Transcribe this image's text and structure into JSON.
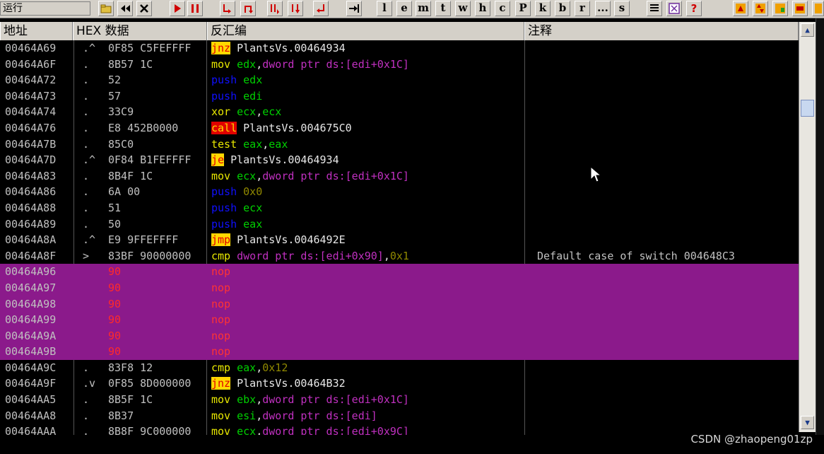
{
  "toolbar": {
    "status_text": "运行",
    "letter_buttons": [
      "l",
      "e",
      "m",
      "t",
      "w",
      "h",
      "c",
      "P",
      "k",
      "b",
      "r",
      "...",
      "s"
    ],
    "help_label": "?"
  },
  "headers": {
    "address": "地址",
    "hex": "HEX 数据",
    "disasm": "反汇编",
    "comment": "注释"
  },
  "rows": [
    {
      "addr": "00464A69",
      "mark": ".^",
      "hex": "0F85 C5FEFFFF",
      "op": "jnz",
      "op_style": "j-yel",
      "args": [
        {
          "t": " PlantsVs.00464934",
          "c": "k-white"
        }
      ],
      "comment": "",
      "sel": false
    },
    {
      "addr": "00464A6F",
      "mark": ".",
      "hex": "8B57 1C",
      "op": "mov",
      "op_style": "k-yel",
      "args": [
        {
          "t": " edx",
          "c": "k-green"
        },
        {
          "t": ",",
          "c": "k-white"
        },
        {
          "t": "dword ptr ds:[edi+0x1C]",
          "c": "k-mag"
        }
      ],
      "comment": "",
      "sel": false
    },
    {
      "addr": "00464A72",
      "mark": ".",
      "hex": "52",
      "op": "push",
      "op_style": "k-blue",
      "args": [
        {
          "t": " edx",
          "c": "k-green"
        }
      ],
      "comment": "",
      "sel": false
    },
    {
      "addr": "00464A73",
      "mark": ".",
      "hex": "57",
      "op": "push",
      "op_style": "k-blue",
      "args": [
        {
          "t": " edi",
          "c": "k-green"
        }
      ],
      "comment": "",
      "sel": false
    },
    {
      "addr": "00464A74",
      "mark": ".",
      "hex": "33C9",
      "op": "xor",
      "op_style": "k-yel",
      "args": [
        {
          "t": " ecx",
          "c": "k-green"
        },
        {
          "t": ",",
          "c": "k-white"
        },
        {
          "t": "ecx",
          "c": "k-green"
        }
      ],
      "comment": "",
      "sel": false
    },
    {
      "addr": "00464A76",
      "mark": ".",
      "hex": "E8 452B0000",
      "op": "call",
      "op_style": "j-red",
      "args": [
        {
          "t": " PlantsVs.004675C0",
          "c": "k-white"
        }
      ],
      "comment": "",
      "sel": false
    },
    {
      "addr": "00464A7B",
      "mark": ".",
      "hex": "85C0",
      "op": "test",
      "op_style": "k-yel",
      "args": [
        {
          "t": " eax",
          "c": "k-green"
        },
        {
          "t": ",",
          "c": "k-white"
        },
        {
          "t": "eax",
          "c": "k-green"
        }
      ],
      "comment": "",
      "sel": false
    },
    {
      "addr": "00464A7D",
      "mark": ".^",
      "hex": "0F84 B1FEFFFF",
      "op": "je",
      "op_style": "j-yel",
      "args": [
        {
          "t": " PlantsVs.00464934",
          "c": "k-white"
        }
      ],
      "comment": "",
      "sel": false
    },
    {
      "addr": "00464A83",
      "mark": ".",
      "hex": "8B4F 1C",
      "op": "mov",
      "op_style": "k-yel",
      "args": [
        {
          "t": " ecx",
          "c": "k-green"
        },
        {
          "t": ",",
          "c": "k-white"
        },
        {
          "t": "dword ptr ds:[edi+0x1C]",
          "c": "k-mag"
        }
      ],
      "comment": "",
      "sel": false
    },
    {
      "addr": "00464A86",
      "mark": ".",
      "hex": "6A 00",
      "op": "push",
      "op_style": "k-blue",
      "args": [
        {
          "t": " 0x0",
          "c": "k-olive"
        }
      ],
      "comment": "",
      "sel": false
    },
    {
      "addr": "00464A88",
      "mark": ".",
      "hex": "51",
      "op": "push",
      "op_style": "k-blue",
      "args": [
        {
          "t": " ecx",
          "c": "k-green"
        }
      ],
      "comment": "",
      "sel": false
    },
    {
      "addr": "00464A89",
      "mark": ".",
      "hex": "50",
      "op": "push",
      "op_style": "k-blue",
      "args": [
        {
          "t": " eax",
          "c": "k-green"
        }
      ],
      "comment": "",
      "sel": false
    },
    {
      "addr": "00464A8A",
      "mark": ".^",
      "hex": "E9 9FFEFFFF",
      "op": "jmp",
      "op_style": "j-yel",
      "args": [
        {
          "t": " PlantsVs.0046492E",
          "c": "k-white"
        }
      ],
      "comment": "",
      "sel": false
    },
    {
      "addr": "00464A8F",
      "mark": ">",
      "hex": "83BF 90000000",
      "op": "cmp",
      "op_style": "k-yel",
      "args": [
        {
          "t": " dword ptr ds:[edi+0x90]",
          "c": "k-mag"
        },
        {
          "t": ",",
          "c": "k-white"
        },
        {
          "t": "0x1",
          "c": "k-olive"
        }
      ],
      "comment": "Default case of switch 004648C3",
      "sel": false
    },
    {
      "addr": "00464A96",
      "mark": "",
      "hex": "90",
      "op": "nop",
      "op_style": "",
      "args": [],
      "comment": "",
      "sel": true
    },
    {
      "addr": "00464A97",
      "mark": "",
      "hex": "90",
      "op": "nop",
      "op_style": "",
      "args": [],
      "comment": "",
      "sel": true
    },
    {
      "addr": "00464A98",
      "mark": "",
      "hex": "90",
      "op": "nop",
      "op_style": "",
      "args": [],
      "comment": "",
      "sel": true
    },
    {
      "addr": "00464A99",
      "mark": "",
      "hex": "90",
      "op": "nop",
      "op_style": "",
      "args": [],
      "comment": "",
      "sel": true
    },
    {
      "addr": "00464A9A",
      "mark": "",
      "hex": "90",
      "op": "nop",
      "op_style": "",
      "args": [],
      "comment": "",
      "sel": true
    },
    {
      "addr": "00464A9B",
      "mark": "",
      "hex": "90",
      "op": "nop",
      "op_style": "",
      "args": [],
      "comment": "",
      "sel": true
    },
    {
      "addr": "00464A9C",
      "mark": ".",
      "hex": "83F8 12",
      "op": "cmp",
      "op_style": "k-yel",
      "args": [
        {
          "t": " eax",
          "c": "k-green"
        },
        {
          "t": ",",
          "c": "k-white"
        },
        {
          "t": "0x12",
          "c": "k-olive"
        }
      ],
      "comment": "",
      "sel": false
    },
    {
      "addr": "00464A9F",
      "mark": ".v",
      "hex": "0F85 8D000000",
      "op": "jnz",
      "op_style": "j-yel",
      "args": [
        {
          "t": " PlantsVs.00464B32",
          "c": "k-white"
        }
      ],
      "comment": "",
      "sel": false
    },
    {
      "addr": "00464AA5",
      "mark": ".",
      "hex": "8B5F 1C",
      "op": "mov",
      "op_style": "k-yel",
      "args": [
        {
          "t": " ebx",
          "c": "k-green"
        },
        {
          "t": ",",
          "c": "k-white"
        },
        {
          "t": "dword ptr ds:[edi+0x1C]",
          "c": "k-mag"
        }
      ],
      "comment": "",
      "sel": false
    },
    {
      "addr": "00464AA8",
      "mark": ".",
      "hex": "8B37",
      "op": "mov",
      "op_style": "k-yel",
      "args": [
        {
          "t": " esi",
          "c": "k-green"
        },
        {
          "t": ",",
          "c": "k-white"
        },
        {
          "t": "dword ptr ds:[edi]",
          "c": "k-mag"
        }
      ],
      "comment": "",
      "sel": false
    },
    {
      "addr": "00464AAA",
      "mark": ".",
      "hex": "8B8F 9C000000",
      "op": "mov",
      "op_style": "k-yel",
      "args": [
        {
          "t": " ecx",
          "c": "k-green"
        },
        {
          "t": ",",
          "c": "k-white"
        },
        {
          "t": "dword ptr ds:[edi+0x9C]",
          "c": "k-mag"
        }
      ],
      "comment": "",
      "sel": false
    }
  ],
  "watermark": "CSDN @zhaopeng01zp",
  "colors": {
    "selection": "#8b1a8b",
    "background": "#000000",
    "jump_highlight": "#ffd800",
    "call_highlight": "#e00000"
  }
}
